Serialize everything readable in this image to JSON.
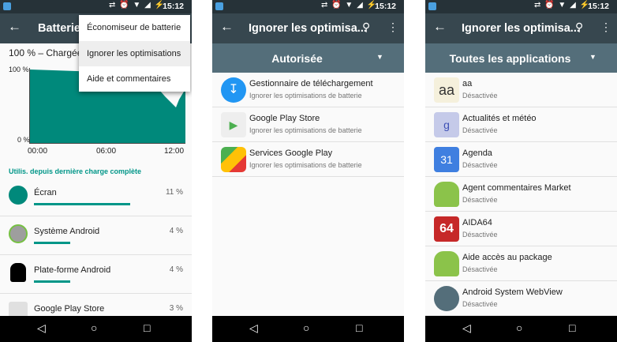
{
  "status": {
    "time": "15:12",
    "icons": "⇄ ⏰ ▼ ◢ ⚡"
  },
  "panel1": {
    "title": "Batterie",
    "charge_text": "100 % – Chargée",
    "menu": [
      "Économiseur de batterie",
      "Ignorer les optimisations",
      "Aide et commentaires"
    ],
    "chart": {
      "ymax_label": "100 %",
      "ymin_label": "0 %",
      "x_labels": [
        "00:00",
        "06:00",
        "12:00"
      ],
      "color": "#00897b"
    },
    "section_label": "Utilis. depuis dernière charge complète",
    "usage": [
      {
        "name": "Écran",
        "pct": "11 %",
        "level": 1.0
      },
      {
        "name": "Système Android",
        "pct": "4 %",
        "level": 0.36
      },
      {
        "name": "Plate-forme Android",
        "pct": "4 %",
        "level": 0.36
      },
      {
        "name": "Google Play Store",
        "pct": "3 %",
        "level": 0.27
      }
    ]
  },
  "panel2": {
    "title": "Ignorer les optimisa...",
    "spinner": "Autorisée",
    "apps": [
      {
        "name": "Gestionnaire de téléchargement",
        "sub": "Ignorer les optimisations de batterie"
      },
      {
        "name": "Google Play Store",
        "sub": "Ignorer les optimisations de batterie"
      },
      {
        "name": "Services Google Play",
        "sub": "Ignorer les optimisations de batterie"
      }
    ]
  },
  "panel3": {
    "title": "Ignorer les optimisa...",
    "spinner": "Toutes les applications",
    "apps": [
      {
        "name": "aa",
        "sub": "Désactivée",
        "icon_text": "aa"
      },
      {
        "name": "Actualités et météo",
        "sub": "Désactivée",
        "icon_text": "g"
      },
      {
        "name": "Agenda",
        "sub": "Désactivée",
        "icon_text": "31"
      },
      {
        "name": "Agent commentaires Market",
        "sub": "Désactivée",
        "icon_text": ""
      },
      {
        "name": "AIDA64",
        "sub": "Désactivée",
        "icon_text": "64"
      },
      {
        "name": "Aide accès au package",
        "sub": "Désactivée",
        "icon_text": ""
      },
      {
        "name": "Android System WebView",
        "sub": "Désactivée",
        "icon_text": ""
      }
    ]
  },
  "nav": {
    "back": "◁",
    "home": "○",
    "recent": "□"
  }
}
